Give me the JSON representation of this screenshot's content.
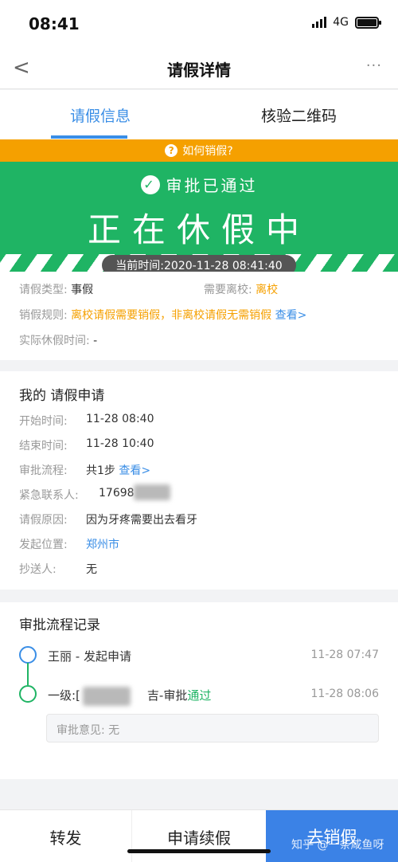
{
  "status_bar": {
    "time": "08:41",
    "network": "4G"
  },
  "nav": {
    "back": "<",
    "title": "请假详情",
    "more": "···"
  },
  "tabs": [
    {
      "label": "请假信息",
      "active": true
    },
    {
      "label": "核验二维码",
      "active": false
    }
  ],
  "howto": {
    "icon": "?",
    "label": "如何销假?"
  },
  "banner": {
    "approved": "审批已通过",
    "state": "正在休假中",
    "current_time": "当前时间:2020-11-28 08:41:40"
  },
  "basic": {
    "type_label": "请假类型:",
    "type_value": "事假",
    "leave_school_label": "需要离校:",
    "leave_school_value": "离校",
    "rule_label": "销假规则:",
    "rule_value": "离校请假需要销假，非离校请假无需销假",
    "rule_link": "查看>",
    "actual_label": "实际休假时间:",
    "actual_value": "-"
  },
  "application": {
    "title": "我的 请假申请",
    "start_label": "开始时间:",
    "start_value": "11-28 08:40",
    "end_label": "结束时间:",
    "end_value": "11-28 10:40",
    "flow_label": "审批流程:",
    "flow_value": "共1步",
    "flow_link": "查看>",
    "contact_label": "紧急联系人:",
    "contact_value": "17698",
    "reason_label": "请假原因:",
    "reason_value": "因为牙疼需要出去看牙",
    "location_label": "发起位置:",
    "location_value": "郑州市",
    "cc_label": "抄送人:",
    "cc_value": "无"
  },
  "flow_record": {
    "title": "审批流程记录",
    "steps": [
      {
        "text": "王丽 - 发起申请",
        "time": "11-28 07:47"
      },
      {
        "text_prefix": "一级:[",
        "text_suffix": "吉-审批",
        "status": "通过",
        "time": "11-28 08:06"
      }
    ],
    "opinion": "审批意见: 无"
  },
  "bottom": {
    "forward": "转发",
    "renew": "申请续假",
    "cancel": "去销假"
  },
  "watermark": "知乎 @一条咸鱼呀",
  "colors": {
    "accent": "#3a8ee6",
    "approved_green": "#1fb464",
    "warning_orange": "#f5a000"
  }
}
